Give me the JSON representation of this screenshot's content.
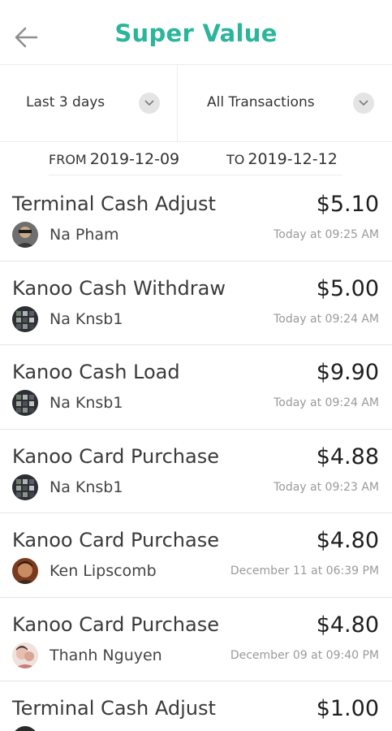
{
  "header": {
    "title": "Super Value",
    "back_icon": "arrow-left-icon"
  },
  "filters": {
    "period": {
      "label": "Last 3 days",
      "icon": "chevron-down-icon"
    },
    "type": {
      "label": "All Transactions",
      "icon": "chevron-down-icon"
    }
  },
  "dates": {
    "from_label": "FROM",
    "from_value": "2019-12-09",
    "to_label": "TO",
    "to_value": "2019-12-12"
  },
  "transactions": [
    {
      "title": "Terminal Cash Adjust",
      "amount": "$5.10",
      "user": "Na Pham",
      "time": "Today at 09:25 AM",
      "avatar": "avatar-photo-icon"
    },
    {
      "title": "Kanoo Cash Withdraw",
      "amount": "$5.00",
      "user": "Na Knsb1",
      "time": "Today at 09:24 AM",
      "avatar": "avatar-photo-icon"
    },
    {
      "title": "Kanoo Cash Load",
      "amount": "$9.90",
      "user": "Na Knsb1",
      "time": "Today at 09:24 AM",
      "avatar": "avatar-photo-icon"
    },
    {
      "title": "Kanoo Card Purchase",
      "amount": "$4.88",
      "user": "Na Knsb1",
      "time": "Today at 09:23 AM",
      "avatar": "avatar-photo-icon"
    },
    {
      "title": "Kanoo Card Purchase",
      "amount": "$4.80",
      "user": "Ken Lipscomb",
      "time": "December 11 at 06:39 PM",
      "avatar": "avatar-photo-icon"
    },
    {
      "title": "Kanoo Card Purchase",
      "amount": "$4.80",
      "user": "Thanh Nguyen",
      "time": "December 09 at 09:40 PM",
      "avatar": "avatar-photo-icon"
    },
    {
      "title": "Terminal Cash Adjust",
      "amount": "$1.00",
      "user": "",
      "time": "",
      "avatar": "avatar-photo-icon"
    }
  ],
  "colors": {
    "accent": "#2bb59a",
    "divider": "#ececec",
    "chevron_bg": "#e4e4e4"
  }
}
